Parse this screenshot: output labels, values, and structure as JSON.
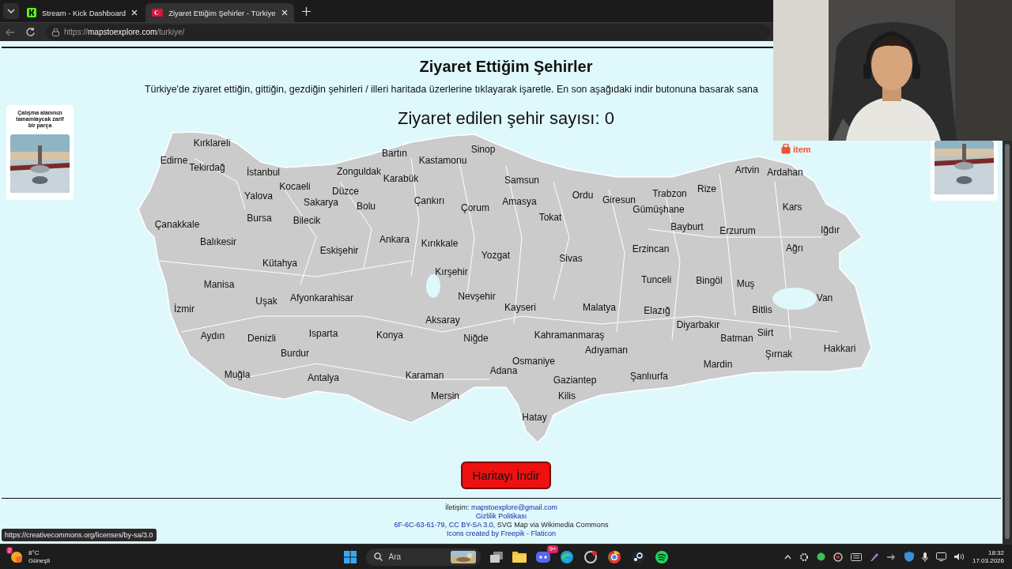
{
  "browser": {
    "tabs": [
      {
        "title": "Stream - Kick Dashboard",
        "selected": false
      },
      {
        "title": "Ziyaret Ettiğim Şehirler - Türkiye",
        "selected": true
      }
    ],
    "url": "https://**mapstoexplore.com**/turkiye/"
  },
  "page": {
    "title": "Ziyaret Ettiğim Şehirler",
    "description": "Türkiye'de ziyaret ettiğin, gittiğin, gezdiğin şehirleri / illeri haritada üzerlerine tıklayarak işaretle. En son aşağıdaki indir butonuna basarak sana",
    "counter": "Ziyaret edilen şehir sayısı: 0",
    "left_ad": {
      "text": "Çalışma alanınızı tamamlaycak zarif bir parça"
    },
    "right_ad": {
      "brand": "item"
    },
    "provinces": [
      "Kırklareli",
      "Bartın",
      "Sinop",
      "Edirne",
      "Kastamonu",
      "Tekirdağ",
      "İstanbul",
      "Zonguldak",
      "Artvin",
      "Ardahan",
      "Karabük",
      "Samsun",
      "Yalova",
      "Kocaeli",
      "Düzce",
      "Ordu",
      "Trabzon",
      "Rize",
      "Sakarya",
      "Bolu",
      "Çankırı",
      "Çorum",
      "Amasya",
      "Giresun",
      "Gümüşhane",
      "Kars",
      "Çanakkale",
      "Bursa",
      "Bilecik",
      "Tokat",
      "Bayburt",
      "Erzurum",
      "Iğdır",
      "Balıkesir",
      "Ankara",
      "Kırıkkale",
      "Eskişehir",
      "Erzincan",
      "Ağrı",
      "Yozgat",
      "Sivas",
      "Kütahya",
      "Kırşehir",
      "Manisa",
      "Tunceli",
      "Bingöl",
      "Muş",
      "Uşak",
      "Afyonkarahisar",
      "Nevşehir",
      "Van",
      "İzmir",
      "Kayseri",
      "Malatya",
      "Elazığ",
      "Bitlis",
      "Aksaray",
      "Diyarbakır",
      "Aydın",
      "Denizli",
      "Isparta",
      "Konya",
      "Niğde",
      "Kahramanmaraş",
      "Batman",
      "Siirt",
      "Burdur",
      "Adıyaman",
      "Şırnak",
      "Hakkari",
      "Osmaniye",
      "Mardin",
      "Adana",
      "Muğla",
      "Antalya",
      "Karaman",
      "Şanlıurfa",
      "Gaziantep",
      "Mersin",
      "Kilis",
      "Hatay"
    ],
    "download_button": "Haritayı İndir",
    "footer": {
      "contact_label": "İletişim:",
      "email": "mapstoexplore@gmail.com",
      "privacy": "Gizlilik Politikası",
      "credits": [
        {
          "kind": "link",
          "text": "6F-6C-63-61-79"
        },
        {
          "kind": "text",
          "text": ", "
        },
        {
          "kind": "link",
          "text": "CC BY-SA 3.0"
        },
        {
          "kind": "text",
          "text": ", SVG Map via Wikimedia Commons"
        }
      ],
      "icons_credit": "Icons created by Freepik - Flaticon"
    }
  },
  "status_url": "https://creativecommons.org/licenses/by-sa/3.0",
  "taskbar": {
    "weather": {
      "badge": "2",
      "temp": "8°C",
      "condition": "Güneşli"
    },
    "search_placeholder": "Ara",
    "chat_badge": "9+",
    "time": "18:32",
    "date": "17.03.2026"
  }
}
